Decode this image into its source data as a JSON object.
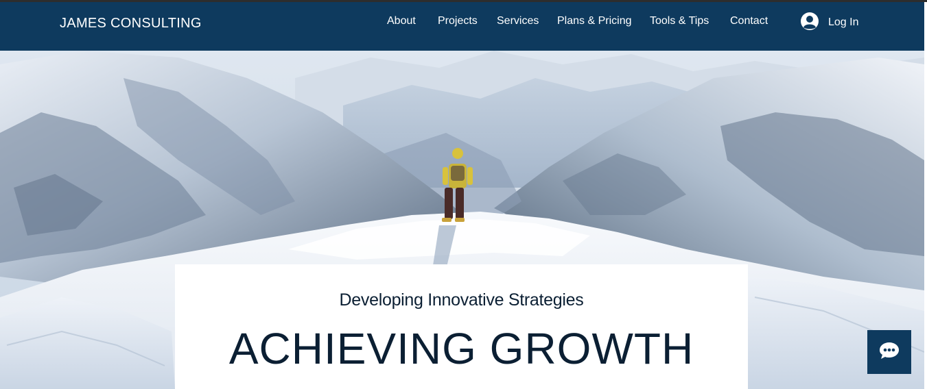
{
  "header": {
    "brand": "JAMES CONSULTING",
    "nav": [
      {
        "label": "About"
      },
      {
        "label": "Projects"
      },
      {
        "label": "Services"
      },
      {
        "label": "Plans & Pricing"
      },
      {
        "label": "Tools & Tips"
      },
      {
        "label": "Contact"
      }
    ],
    "login_label": "Log In"
  },
  "hero": {
    "subtitle": "Developing Innovative Strategies",
    "title": "ACHIEVING GROWTH"
  },
  "icons": {
    "login": "user-avatar-icon",
    "chat": "chat-bubble-icon"
  },
  "colors": {
    "header_bg": "#0e3a5e",
    "text_dark": "#0b1f33",
    "chat_button": "#0e3a5e"
  }
}
